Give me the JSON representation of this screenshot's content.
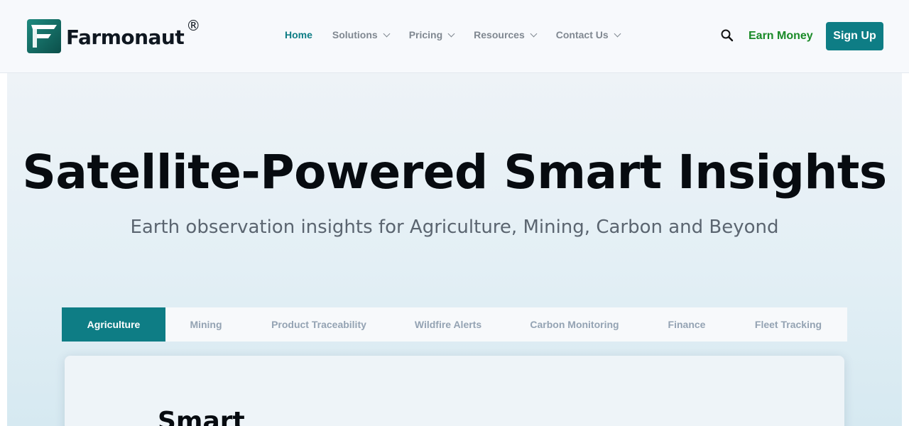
{
  "header": {
    "logo_name": "Farmonaut",
    "logo_reg": "®",
    "logo_icon": "farmonaut-f-icon",
    "nav": [
      {
        "label": "Home",
        "active": true,
        "dropdown": false
      },
      {
        "label": "Solutions",
        "active": false,
        "dropdown": true
      },
      {
        "label": "Pricing",
        "active": false,
        "dropdown": true
      },
      {
        "label": "Resources",
        "active": false,
        "dropdown": true
      },
      {
        "label": "Contact Us",
        "active": false,
        "dropdown": true
      }
    ],
    "search_icon": "search-icon",
    "earn_money": "Earn Money",
    "sign_up": "Sign Up"
  },
  "hero": {
    "title": "Satellite-Powered Smart Insights",
    "subtitle": "Earth observation insights for Agriculture, Mining, Carbon and Beyond"
  },
  "tabs": [
    {
      "label": "Agriculture",
      "active": true
    },
    {
      "label": "Mining",
      "active": false
    },
    {
      "label": "Product Traceability",
      "active": false
    },
    {
      "label": "Wildfire Alerts",
      "active": false
    },
    {
      "label": "Carbon Monitoring",
      "active": false
    },
    {
      "label": "Finance",
      "active": false
    },
    {
      "label": "Fleet Tracking",
      "active": false
    }
  ],
  "card": {
    "title": "Smart"
  },
  "colors": {
    "brand_teal": "#0e7d85",
    "earn_green": "#198a27",
    "nav_gray": "#808891"
  }
}
